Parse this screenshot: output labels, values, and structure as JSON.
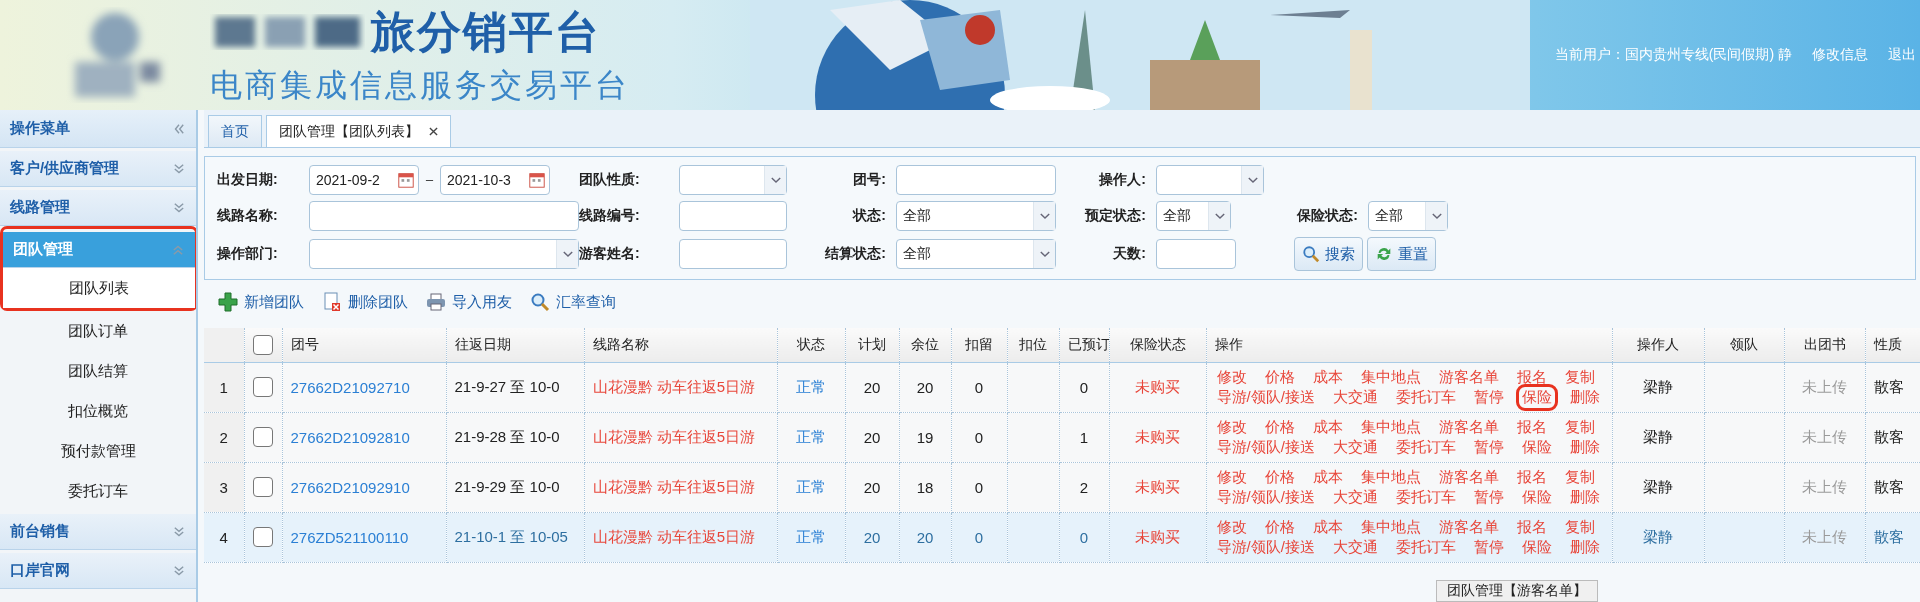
{
  "header": {
    "title": "旅分销平台",
    "subtitle": "电商集成信息服务交易平台",
    "user_label": "当前用户：国内贵州专线(民间假期) 静",
    "links": [
      "修改信息",
      "退出"
    ]
  },
  "sidebar": {
    "title": "操作菜单",
    "groups": [
      {
        "label": "客户/供应商管理",
        "expanded": false,
        "circled": false
      },
      {
        "label": "线路管理",
        "expanded": false,
        "circled": false
      },
      {
        "label": "团队管理",
        "expanded": true,
        "circled": true,
        "items": [
          {
            "label": "团队列表",
            "selected": true,
            "circled": true
          },
          {
            "label": "团队订单",
            "selected": false,
            "circled": false
          },
          {
            "label": "团队结算",
            "selected": false,
            "circled": false
          },
          {
            "label": "扣位概览",
            "selected": false,
            "circled": false
          },
          {
            "label": "预付款管理",
            "selected": false,
            "circled": false
          },
          {
            "label": "委托订车",
            "selected": false,
            "circled": false
          }
        ]
      },
      {
        "label": "前台销售",
        "expanded": false,
        "circled": false
      },
      {
        "label": "口岸官网",
        "expanded": false,
        "circled": false
      }
    ]
  },
  "tabs": [
    {
      "label": "首页",
      "selected": false,
      "closable": false
    },
    {
      "label": "团队管理【团队列表】",
      "selected": true,
      "closable": true
    }
  ],
  "filters": [
    {
      "label": "出发日期:",
      "kind": "date-range",
      "value": "2021-09-2",
      "value2": "2021-10-3"
    },
    {
      "label": "团队性质:",
      "kind": "select"
    },
    {
      "label": "团号:",
      "kind": "text"
    },
    {
      "label": "操作人:",
      "kind": "select"
    },
    {
      "label": "线路名称:",
      "kind": "text"
    },
    {
      "label": "线路编号:",
      "kind": "text"
    },
    {
      "label": "状态:",
      "kind": "select",
      "value": "全部"
    },
    {
      "label": "预定状态:",
      "kind": "select",
      "value": "全部"
    },
    {
      "label": "保险状态:",
      "kind": "select",
      "value": "全部"
    },
    {
      "label": "操作部门:",
      "kind": "select"
    },
    {
      "label": "游客姓名:",
      "kind": "text"
    },
    {
      "label": "结算状态:",
      "kind": "select",
      "value": "全部"
    },
    {
      "label": "天数:",
      "kind": "text"
    }
  ],
  "filter_buttons": [
    {
      "label": "搜索",
      "kind": "search"
    },
    {
      "label": "重置",
      "kind": "reset"
    }
  ],
  "toolbar": [
    {
      "label": "新增团队",
      "kind": "add"
    },
    {
      "label": "删除团队",
      "kind": "delete"
    },
    {
      "label": "导入用友",
      "kind": "print"
    },
    {
      "label": "汇率查询",
      "kind": "search"
    }
  ],
  "table": {
    "all_checked": false,
    "columns": [
      "团号",
      "往返日期",
      "线路名称",
      "状态",
      "计划",
      "余位",
      "扣留",
      "扣位",
      "已预订",
      "保险状态",
      "操作",
      "操作人",
      "领队",
      "出团书",
      "性质"
    ],
    "rows": [
      {
        "index": "1",
        "checked": false,
        "selected": false,
        "code": "27662D21092710",
        "dates": "21-9-27 至 10-0",
        "route": "山花漫黔 动车往返5日游",
        "status": "正常",
        "plan": "20",
        "remaining": "20",
        "held": "0",
        "deducted": "",
        "booked": "0",
        "insurance": "未购买",
        "operations": [
          [
            {
              "label": "修改",
              "circled": false
            },
            {
              "label": "价格",
              "circled": false
            },
            {
              "label": "成本",
              "circled": false
            },
            {
              "label": "集中地点",
              "circled": false
            },
            {
              "label": "游客名单",
              "circled": false
            },
            {
              "label": "报名",
              "circled": false
            },
            {
              "label": "复制",
              "circled": false
            }
          ],
          [
            {
              "label": "导游/领队/接送",
              "circled": false
            },
            {
              "label": "大交通",
              "circled": false
            },
            {
              "label": "委托订车",
              "circled": false
            },
            {
              "label": "暂停",
              "circled": false
            },
            {
              "label": "保险",
              "circled": true
            },
            {
              "label": "删除",
              "circled": false
            }
          ]
        ],
        "operator": "梁静",
        "leader": "",
        "document": "未上传",
        "type": "散客"
      },
      {
        "index": "2",
        "checked": false,
        "selected": false,
        "code": "27662D21092810",
        "dates": "21-9-28 至 10-0",
        "route": "山花漫黔 动车往返5日游",
        "status": "正常",
        "plan": "20",
        "remaining": "19",
        "held": "0",
        "deducted": "",
        "booked": "1",
        "insurance": "未购买",
        "operations": [
          [
            {
              "label": "修改",
              "circled": false
            },
            {
              "label": "价格",
              "circled": false
            },
            {
              "label": "成本",
              "circled": false
            },
            {
              "label": "集中地点",
              "circled": false
            },
            {
              "label": "游客名单",
              "circled": false
            },
            {
              "label": "报名",
              "circled": false
            },
            {
              "label": "复制",
              "circled": false
            }
          ],
          [
            {
              "label": "导游/领队/接送",
              "circled": false
            },
            {
              "label": "大交通",
              "circled": false
            },
            {
              "label": "委托订车",
              "circled": false
            },
            {
              "label": "暂停",
              "circled": false
            },
            {
              "label": "保险",
              "circled": false
            },
            {
              "label": "删除",
              "circled": false
            }
          ]
        ],
        "operator": "梁静",
        "leader": "",
        "document": "未上传",
        "type": "散客"
      },
      {
        "index": "3",
        "checked": false,
        "selected": false,
        "code": "27662D21092910",
        "dates": "21-9-29 至 10-0",
        "route": "山花漫黔 动车往返5日游",
        "status": "正常",
        "plan": "20",
        "remaining": "18",
        "held": "0",
        "deducted": "",
        "booked": "2",
        "insurance": "未购买",
        "operations": [
          [
            {
              "label": "修改",
              "circled": false
            },
            {
              "label": "价格",
              "circled": false
            },
            {
              "label": "成本",
              "circled": false
            },
            {
              "label": "集中地点",
              "circled": false
            },
            {
              "label": "游客名单",
              "circled": false
            },
            {
              "label": "报名",
              "circled": false
            },
            {
              "label": "复制",
              "circled": false
            }
          ],
          [
            {
              "label": "导游/领队/接送",
              "circled": false
            },
            {
              "label": "大交通",
              "circled": false
            },
            {
              "label": "委托订车",
              "circled": false
            },
            {
              "label": "暂停",
              "circled": false
            },
            {
              "label": "保险",
              "circled": false
            },
            {
              "label": "删除",
              "circled": false
            }
          ]
        ],
        "operator": "梁静",
        "leader": "",
        "document": "未上传",
        "type": "散客"
      },
      {
        "index": "4",
        "checked": false,
        "selected": true,
        "code": "276ZD521100110",
        "dates": "21-10-1 至 10-05",
        "route": "山花漫黔 动车往返5日游",
        "status": "正常",
        "plan": "20",
        "remaining": "20",
        "held": "0",
        "deducted": "",
        "booked": "0",
        "insurance": "未购买",
        "operations": [
          [
            {
              "label": "修改",
              "circled": false
            },
            {
              "label": "价格",
              "circled": false
            },
            {
              "label": "成本",
              "circled": false
            },
            {
              "label": "集中地点",
              "circled": false
            },
            {
              "label": "游客名单",
              "circled": false
            },
            {
              "label": "报名",
              "circled": false
            },
            {
              "label": "复制",
              "circled": false
            }
          ],
          [
            {
              "label": "导游/领队/接送",
              "circled": false
            },
            {
              "label": "大交通",
              "circled": false
            },
            {
              "label": "委托订车",
              "circled": false
            },
            {
              "label": "暂停",
              "circled": false
            },
            {
              "label": "保险",
              "circled": false
            },
            {
              "label": "删除",
              "circled": false
            }
          ]
        ],
        "operator": "梁静",
        "leader": "",
        "document": "未上传",
        "type": "散客"
      }
    ]
  },
  "tooltip": "团队管理【游客名单】"
}
